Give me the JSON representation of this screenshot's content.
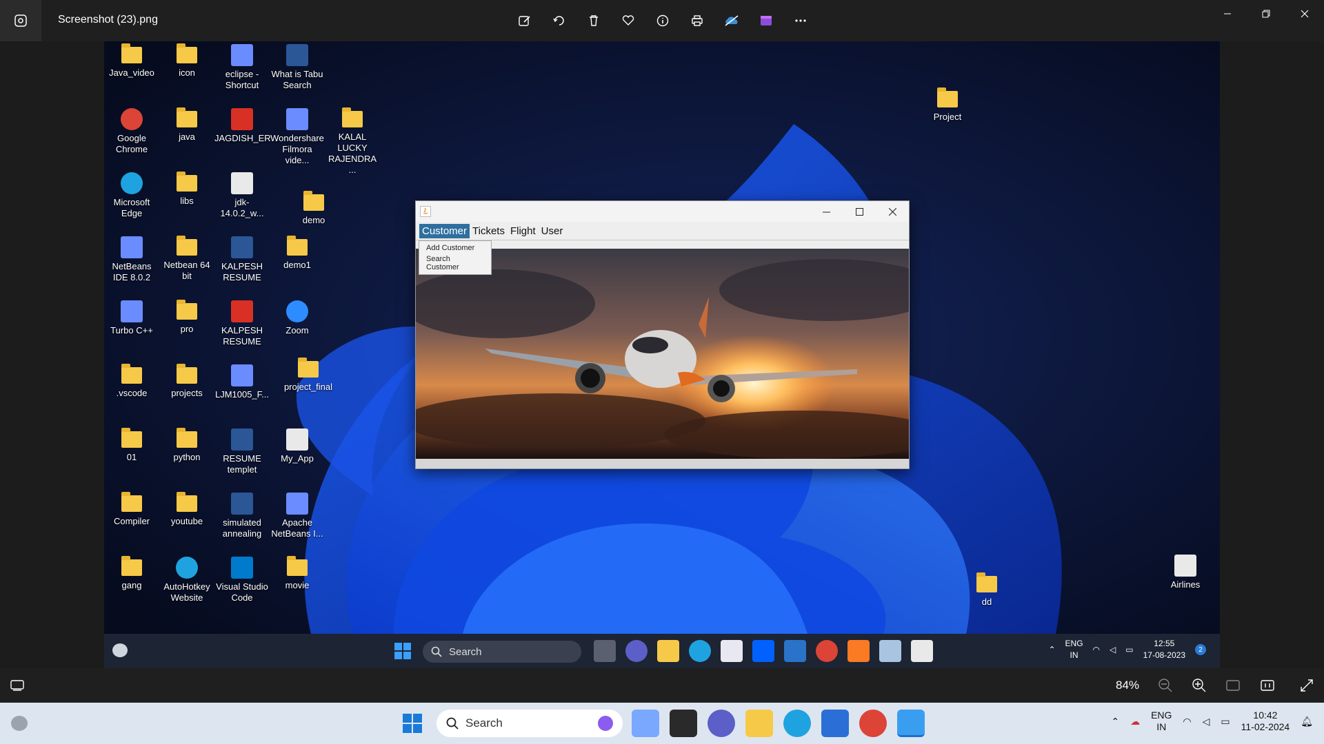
{
  "app": {
    "title": "Screenshot (23).png",
    "zoom": "84%"
  },
  "desktop": {
    "icons": [
      {
        "label": "Java_video",
        "col": 0,
        "row": 0,
        "kind": "folder"
      },
      {
        "label": "icon",
        "col": 1,
        "row": 0,
        "kind": "folder"
      },
      {
        "label": "eclipse - Shortcut",
        "col": 2,
        "row": 0,
        "kind": "app"
      },
      {
        "label": "What is Tabu Search",
        "col": 3,
        "row": 0,
        "kind": "word"
      },
      {
        "label": "Google Chrome",
        "col": 0,
        "row": 1,
        "kind": "chrome"
      },
      {
        "label": "java",
        "col": 1,
        "row": 1,
        "kind": "folder"
      },
      {
        "label": "JAGDISH_ER",
        "col": 2,
        "row": 1,
        "kind": "pdf"
      },
      {
        "label": "Wondershare Filmora vide...",
        "col": 3,
        "row": 1,
        "kind": "app"
      },
      {
        "label": "KALAL LUCKY RAJENDRA ...",
        "col": 4,
        "row": 1,
        "kind": "folder"
      },
      {
        "label": "Microsoft Edge",
        "col": 0,
        "row": 2,
        "kind": "edge"
      },
      {
        "label": "libs",
        "col": 1,
        "row": 2,
        "kind": "folder"
      },
      {
        "label": "jdk-14.0.2_w...",
        "col": 2,
        "row": 2,
        "kind": "java"
      },
      {
        "label": "demo",
        "col": 3.3,
        "row": 2.3,
        "kind": "folder"
      },
      {
        "label": "NetBeans IDE 8.0.2",
        "col": 0,
        "row": 3,
        "kind": "app"
      },
      {
        "label": "Netbean 64 bit",
        "col": 1,
        "row": 3,
        "kind": "folder"
      },
      {
        "label": "KALPESH RESUME",
        "col": 2,
        "row": 3,
        "kind": "word"
      },
      {
        "label": "demo1",
        "col": 3,
        "row": 3,
        "kind": "folder"
      },
      {
        "label": "Turbo C++",
        "col": 0,
        "row": 4,
        "kind": "app"
      },
      {
        "label": "pro",
        "col": 1,
        "row": 4,
        "kind": "folder"
      },
      {
        "label": "KALPESH RESUME",
        "col": 2,
        "row": 4,
        "kind": "pdf"
      },
      {
        "label": "Zoom",
        "col": 3,
        "row": 4,
        "kind": "zoom"
      },
      {
        "label": ".vscode",
        "col": 0,
        "row": 5,
        "kind": "folder"
      },
      {
        "label": "projects",
        "col": 1,
        "row": 5,
        "kind": "folder"
      },
      {
        "label": "LJM1005_F...",
        "col": 2,
        "row": 5,
        "kind": "app"
      },
      {
        "label": "project_final",
        "col": 3.2,
        "row": 4.9,
        "kind": "folder"
      },
      {
        "label": "01",
        "col": 0,
        "row": 6,
        "kind": "folder"
      },
      {
        "label": "python",
        "col": 1,
        "row": 6,
        "kind": "folder"
      },
      {
        "label": "RESUME templet",
        "col": 2,
        "row": 6,
        "kind": "word"
      },
      {
        "label": "My_App",
        "col": 3,
        "row": 6,
        "kind": "java"
      },
      {
        "label": "Compiler",
        "col": 0,
        "row": 7,
        "kind": "folder"
      },
      {
        "label": "youtube",
        "col": 1,
        "row": 7,
        "kind": "folder"
      },
      {
        "label": "simulated annealing",
        "col": 2,
        "row": 7,
        "kind": "word"
      },
      {
        "label": "Apache NetBeans I...",
        "col": 3,
        "row": 7,
        "kind": "app"
      },
      {
        "label": "gang",
        "col": 0,
        "row": 8,
        "kind": "folder"
      },
      {
        "label": "AutoHotkey Website",
        "col": 1,
        "row": 8,
        "kind": "edge"
      },
      {
        "label": "Visual Studio Code",
        "col": 2,
        "row": 8,
        "kind": "vscode"
      },
      {
        "label": "movie",
        "col": 3,
        "row": 8,
        "kind": "folder"
      }
    ],
    "right_icons": [
      {
        "label": "Project",
        "kind": "folder"
      },
      {
        "label": "dd",
        "kind": "folder"
      },
      {
        "label": "Airlines",
        "kind": "java"
      }
    ]
  },
  "java_window": {
    "menus": [
      "Customer",
      "Tickets",
      "Flight",
      "User"
    ],
    "active_menu": "Customer",
    "dropdown_items": [
      "Add Customer",
      "Search Customer"
    ]
  },
  "inner_taskbar": {
    "search_label": "Search",
    "lang_line1": "ENG",
    "lang_line2": "IN",
    "time": "12:55",
    "date": "17-08-2023",
    "notification_count": "2"
  },
  "host_taskbar": {
    "search_label": "Search",
    "lang_line1": "ENG",
    "lang_line2": "IN",
    "time": "10:42",
    "date": "11-02-2024"
  }
}
